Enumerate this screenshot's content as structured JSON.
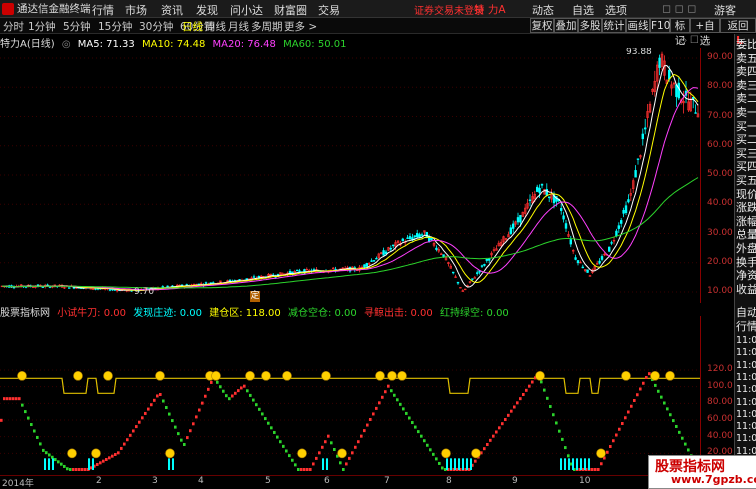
{
  "menubar": {
    "app_title": "通达信金融终端",
    "items": [
      "行情",
      "市场",
      "资讯",
      "发现",
      "问小达",
      "财富圈",
      "交易"
    ],
    "warning": "证券交易未登录",
    "stock_name": "特 力A",
    "right_items": [
      "动态",
      "自选",
      "选项"
    ],
    "user": "游客"
  },
  "toolbar": {
    "periods": [
      "分时",
      "1分钟",
      "5分钟",
      "15分钟",
      "30分钟",
      "60分钟",
      "日线",
      "周线",
      "月线",
      "多周期",
      "更多 >"
    ],
    "active": "日线",
    "right_buttons": [
      "复权",
      "叠加",
      "多股",
      "统计",
      "画线",
      "F10",
      "标记",
      "+自选",
      "返回"
    ]
  },
  "legend": {
    "name": "特力A",
    "period": "(日线)",
    "ma5": "MA5: 71.33",
    "ma10": "MA10: 74.48",
    "ma20": "MA20: 76.48",
    "ma60": "MA60: 50.01"
  },
  "colors": {
    "ma5": "#ffffff",
    "ma10": "#ffff00",
    "ma20": "#ff40ff",
    "ma60": "#2cd42c",
    "up": "#ff3030",
    "down": "#00ffff",
    "bg": "#000000"
  },
  "price_axis": {
    "ticks": [
      "90.00",
      "80.00",
      "70.00",
      "60.00",
      "50.00",
      "40.00",
      "30.00",
      "20.00",
      "10.00"
    ]
  },
  "chart_annotations": {
    "high_label": "93.88",
    "low_label": "9.70",
    "marker": "定"
  },
  "sub_legend": {
    "name": "股票指标网",
    "items": [
      {
        "label": "小试牛刀: 0.00",
        "color": "#ff3030"
      },
      {
        "label": "发现庄迹: 0.00",
        "color": "#00ffff"
      },
      {
        "label": "建仓区: 118.00",
        "color": "#ffff00"
      },
      {
        "label": "减仓空仓: 0.00",
        "color": "#2cd42c"
      },
      {
        "label": "寻鲸出击: 0.00",
        "color": "#ff3030"
      },
      {
        "label": "红持绿空: 0.00",
        "color": "#2cd42c"
      }
    ]
  },
  "sub_axis": {
    "ticks": [
      "120.0",
      "100.0",
      "80.00",
      "60.00",
      "40.00",
      "20.00"
    ]
  },
  "x_axis": {
    "labels": [
      "2014年",
      "2",
      "3",
      "4",
      "5",
      "6",
      "7",
      "8",
      "9",
      "10"
    ]
  },
  "right_panel": {
    "top_flag": "L",
    "quote_labels": [
      "委比",
      "卖五",
      "卖四",
      "卖三",
      "卖二",
      "卖一",
      "买一",
      "买二",
      "买三",
      "买四",
      "买五",
      "现价",
      "涨跌",
      "涨幅",
      "总量",
      "外盘",
      "换手",
      "净资",
      "收益"
    ],
    "lower_labels": [
      "自动",
      "行情"
    ],
    "times": [
      "11:0",
      "11:0",
      "11:0",
      "11:0",
      "11:0",
      "11:0",
      "11:0",
      "11:0",
      "11:0",
      "11:0",
      "11:0",
      "11:0"
    ]
  },
  "watermark": {
    "line1": "股票指标网",
    "line2": "www.7gpzb.com"
  }
}
